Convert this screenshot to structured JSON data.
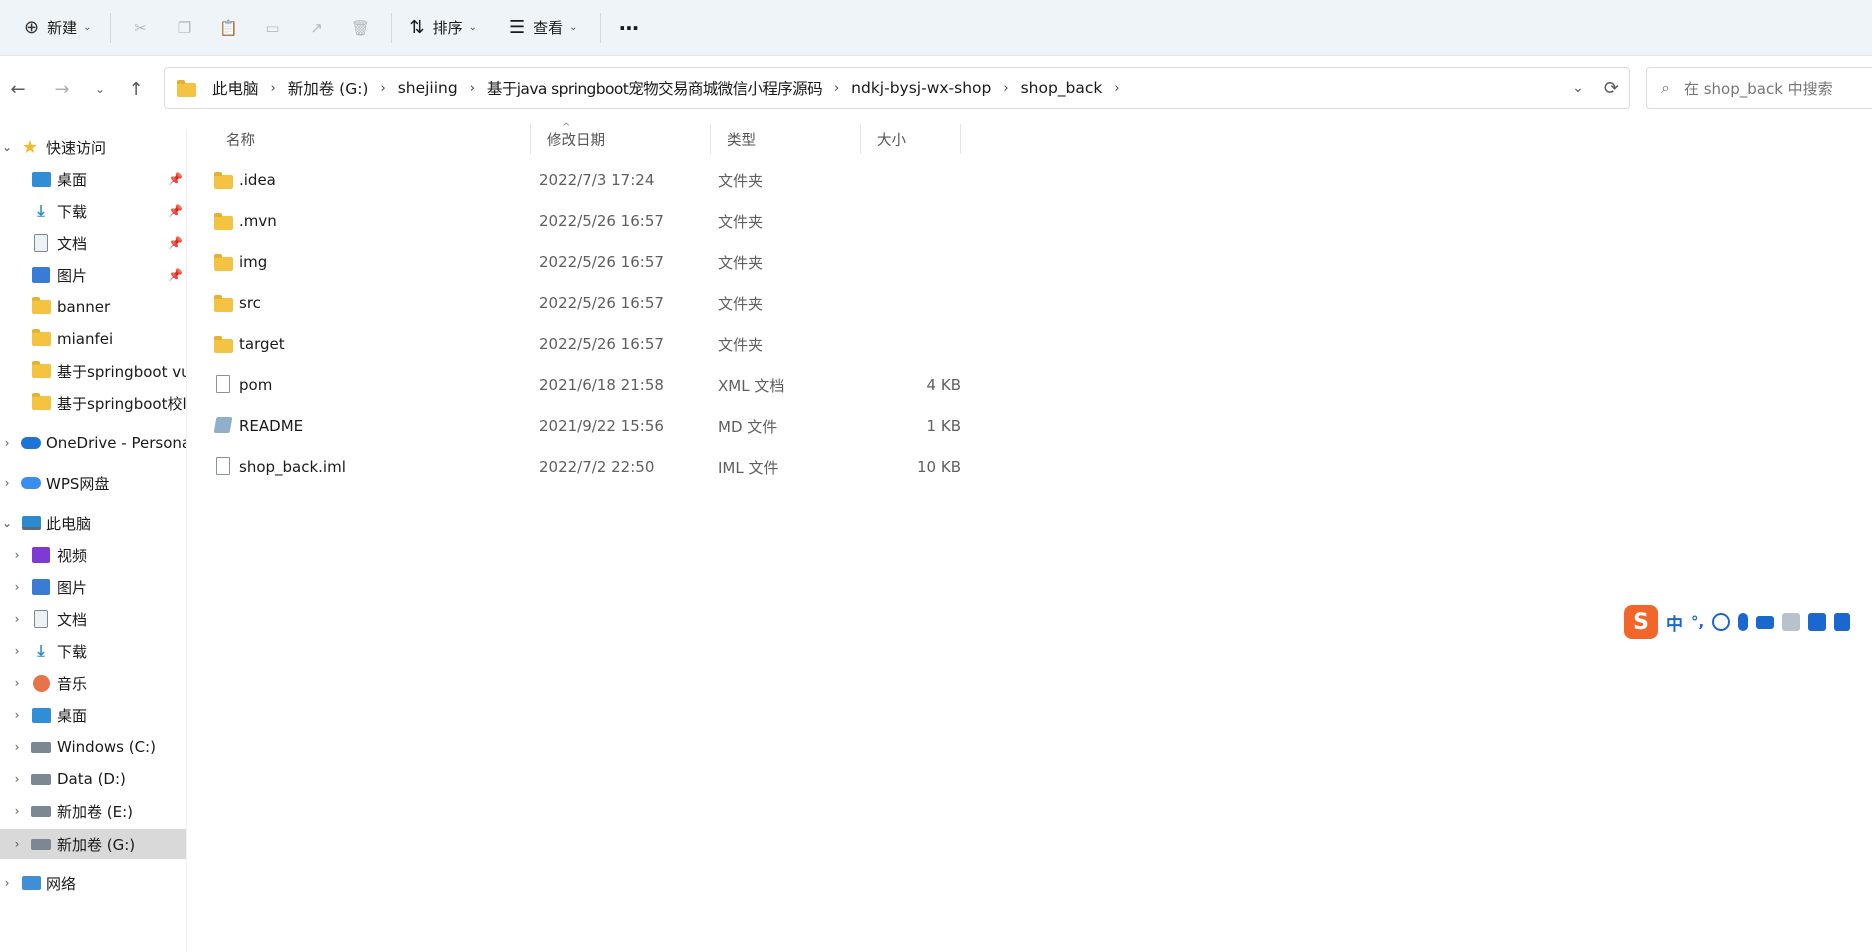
{
  "toolbar": {
    "new_label": "新建",
    "sort_label": "排序",
    "view_label": "查看",
    "more_label": "···"
  },
  "address_bar": {
    "crumbs": [
      "此电脑",
      "新加卷 (G:)",
      "shejiing",
      "基于java springboot宠物交易商城微信小程序源码",
      "ndkj-bysj-wx-shop",
      "shop_back"
    ]
  },
  "search": {
    "placeholder": "在 shop_back 中搜索"
  },
  "sidebar": {
    "quick_access": "快速访问",
    "quick_items": [
      {
        "label": "桌面",
        "icon": "desktop-icon",
        "pinned": true
      },
      {
        "label": "下载",
        "icon": "download-icon",
        "pinned": true
      },
      {
        "label": "文档",
        "icon": "document-icon",
        "pinned": true
      },
      {
        "label": "图片",
        "icon": "picture-icon",
        "pinned": true
      },
      {
        "label": "banner",
        "icon": "folder-icon",
        "pinned": false
      },
      {
        "label": "mianfei",
        "icon": "folder-icon",
        "pinned": false
      },
      {
        "label": "基于springboot vu",
        "icon": "folder-icon",
        "pinned": false
      },
      {
        "label": "基于springboot校l",
        "icon": "folder-icon",
        "pinned": false
      }
    ],
    "onedrive": "OneDrive - Persona",
    "wps": "WPS网盘",
    "this_pc": "此电脑",
    "pc_items": [
      {
        "label": "视频",
        "icon": "video-icon"
      },
      {
        "label": "图片",
        "icon": "picture-icon"
      },
      {
        "label": "文档",
        "icon": "document-icon"
      },
      {
        "label": "下载",
        "icon": "download-icon"
      },
      {
        "label": "音乐",
        "icon": "music-icon"
      },
      {
        "label": "桌面",
        "icon": "desktop-icon"
      },
      {
        "label": "Windows (C:)",
        "icon": "drive-icon"
      },
      {
        "label": "Data (D:)",
        "icon": "drive-icon"
      },
      {
        "label": "新加卷 (E:)",
        "icon": "drive-icon"
      },
      {
        "label": "新加卷 (G:)",
        "icon": "drive-icon",
        "selected": true
      }
    ],
    "network": "网络"
  },
  "columns": {
    "name": "名称",
    "date": "修改日期",
    "type": "类型",
    "size": "大小"
  },
  "files": [
    {
      "name": ".idea",
      "date": "2022/7/3 17:24",
      "type": "文件夹",
      "size": "",
      "icon": "folder-icon"
    },
    {
      "name": ".mvn",
      "date": "2022/5/26 16:57",
      "type": "文件夹",
      "size": "",
      "icon": "folder-icon"
    },
    {
      "name": "img",
      "date": "2022/5/26 16:57",
      "type": "文件夹",
      "size": "",
      "icon": "folder-icon"
    },
    {
      "name": "src",
      "date": "2022/5/26 16:57",
      "type": "文件夹",
      "size": "",
      "icon": "folder-icon"
    },
    {
      "name": "target",
      "date": "2022/5/26 16:57",
      "type": "文件夹",
      "size": "",
      "icon": "folder-icon"
    },
    {
      "name": "pom",
      "date": "2021/6/18 21:58",
      "type": "XML 文档",
      "size": "4 KB",
      "icon": "file-icon"
    },
    {
      "name": "README",
      "date": "2021/9/22 15:56",
      "type": "MD 文件",
      "size": "1 KB",
      "icon": "markdown-file-icon"
    },
    {
      "name": "shop_back.iml",
      "date": "2022/7/2 22:50",
      "type": "IML 文件",
      "size": "10 KB",
      "icon": "file-icon"
    }
  ],
  "ime": {
    "logo": "S",
    "mode": "中",
    "punct": "°,"
  }
}
